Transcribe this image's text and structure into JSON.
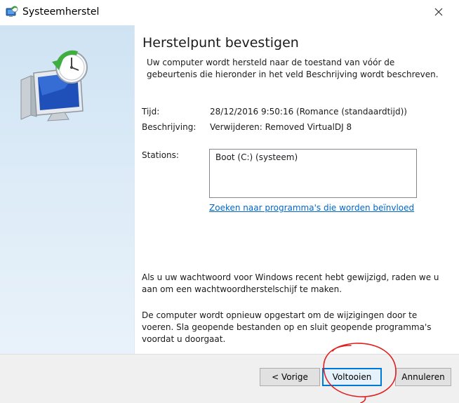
{
  "window": {
    "title": "Systeemherstel",
    "close_glyph": "✕"
  },
  "icons": {
    "title_icon": "system-restore-icon",
    "hero_icon": "monitor-restore-clock-icon",
    "close_icon": "close-icon"
  },
  "main": {
    "heading": "Herstelpunt bevestigen",
    "intro": "Uw computer wordt hersteld naar de toestand van vóór de gebeurtenis die hieronder in het veld Beschrijving wordt beschreven.",
    "time_label": "Tijd:",
    "time_value": "28/12/2016 9:50:16 (Romance (standaardtijd))",
    "description_label": "Beschrijving:",
    "description_value": "Verwijderen: Removed VirtualDJ 8",
    "stations_label": "Stations:",
    "stations_items": [
      "Boot (C:) (systeem)"
    ],
    "scan_link": "Zoeken naar programma's die worden beïnvloed",
    "password_notice": "Als u uw wachtwoord voor Windows recent hebt gewijzigd, raden we u aan om een wachtwoordherstelschijf te maken.",
    "restart_notice": "De computer wordt opnieuw opgestart om de wijzigingen door te voeren. Sla geopende bestanden op en sluit geopende programma's voordat u doorgaat."
  },
  "footer": {
    "back_label": "< Vorige",
    "finish_label": "Voltooien",
    "cancel_label": "Annuleren"
  },
  "colors": {
    "accent": "#0078d7",
    "link": "#0066cc",
    "annotation": "#e02020"
  }
}
